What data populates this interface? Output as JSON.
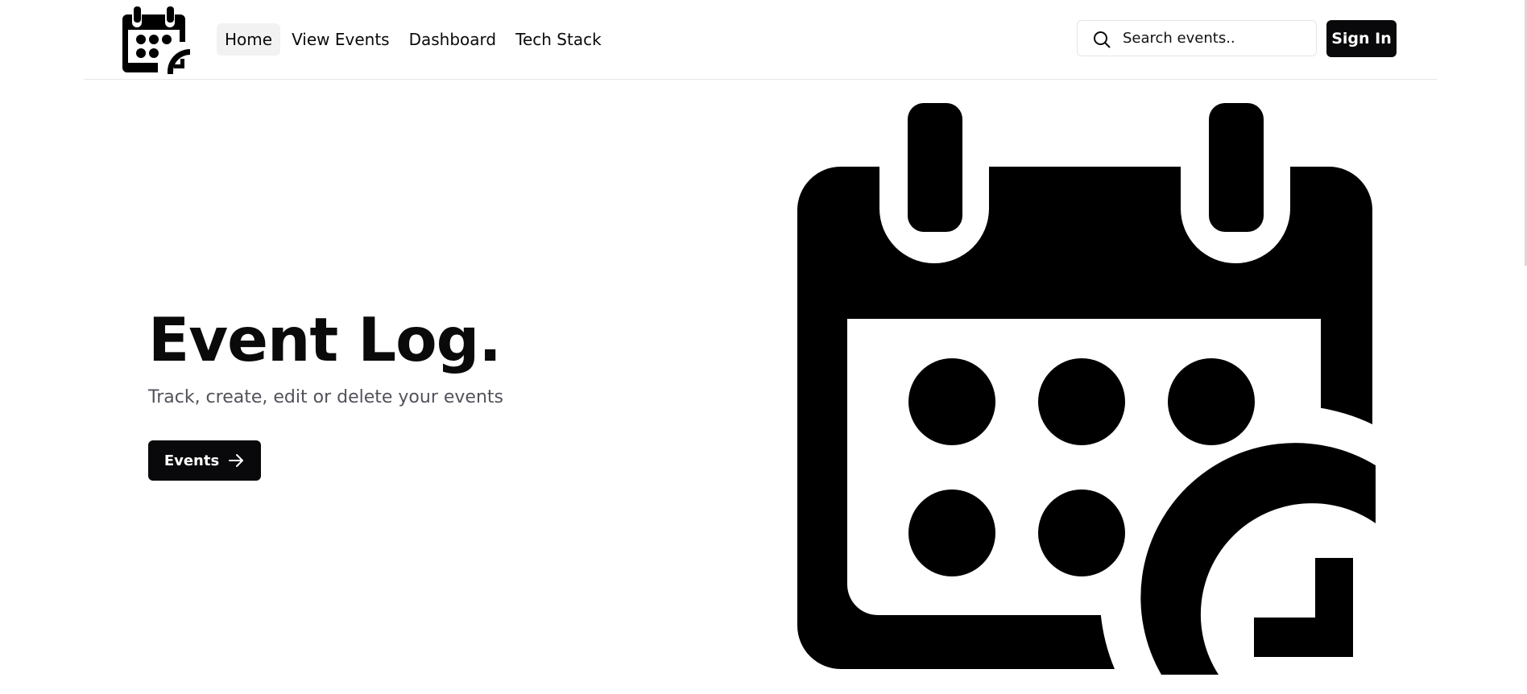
{
  "header": {
    "nav": [
      {
        "label": "Home",
        "active": true
      },
      {
        "label": "View Events",
        "active": false
      },
      {
        "label": "Dashboard",
        "active": false
      },
      {
        "label": "Tech Stack",
        "active": false
      }
    ],
    "search": {
      "placeholder": "Search events..",
      "value": "",
      "icon": "search-icon"
    },
    "sign_in_label": "Sign In",
    "logo_icon": "calendar-clock-icon"
  },
  "hero": {
    "title": "Event Log.",
    "subtitle": "Track, create, edit or delete your events",
    "cta_label": "Events",
    "cta_icon": "arrow-right-icon",
    "illustration_icon": "calendar-clock-icon"
  },
  "colors": {
    "primary": "#09090b",
    "text": "#0a0a0a",
    "muted_text": "#52525b",
    "nav_active_bg": "#f2f2f3",
    "border": "#e5e7eb",
    "background": "#ffffff"
  }
}
